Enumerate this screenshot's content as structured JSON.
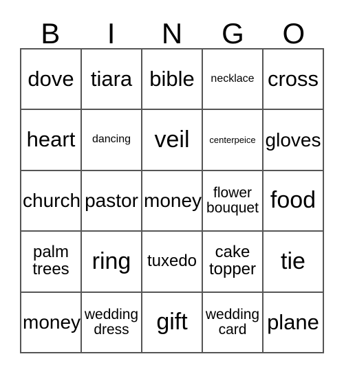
{
  "card": {
    "title": "BINGO",
    "headers": [
      "B",
      "I",
      "N",
      "G",
      "O"
    ],
    "colors": {
      "border": "#555555",
      "text": "#000000",
      "background": "#ffffff"
    },
    "rows": [
      [
        {
          "label": "dove",
          "size": "xl"
        },
        {
          "label": "tiara",
          "size": "xl"
        },
        {
          "label": "bible",
          "size": "xl"
        },
        {
          "label": "necklace",
          "size": "xs"
        },
        {
          "label": "cross",
          "size": "xl"
        }
      ],
      [
        {
          "label": "heart",
          "size": "xl"
        },
        {
          "label": "dancing",
          "size": "xs"
        },
        {
          "label": "veil",
          "size": "xxl"
        },
        {
          "label": "centerpeice",
          "size": "xxs"
        },
        {
          "label": "gloves",
          "size": "lg"
        }
      ],
      [
        {
          "label": "church",
          "size": "lg"
        },
        {
          "label": "pastor",
          "size": "lg"
        },
        {
          "label": "money",
          "size": "lg"
        },
        {
          "label": "flower\nbouquet",
          "size": "sm"
        },
        {
          "label": "food",
          "size": "xxl"
        }
      ],
      [
        {
          "label": "palm\ntrees",
          "size": "md"
        },
        {
          "label": "ring",
          "size": "xxl"
        },
        {
          "label": "tuxedo",
          "size": "md"
        },
        {
          "label": "cake\ntopper",
          "size": "md"
        },
        {
          "label": "tie",
          "size": "xxl"
        }
      ],
      [
        {
          "label": "money",
          "size": "lg"
        },
        {
          "label": "wedding\ndress",
          "size": "sm"
        },
        {
          "label": "gift",
          "size": "xxl"
        },
        {
          "label": "wedding\ncard",
          "size": "sm"
        },
        {
          "label": "plane",
          "size": "xl"
        }
      ]
    ]
  }
}
